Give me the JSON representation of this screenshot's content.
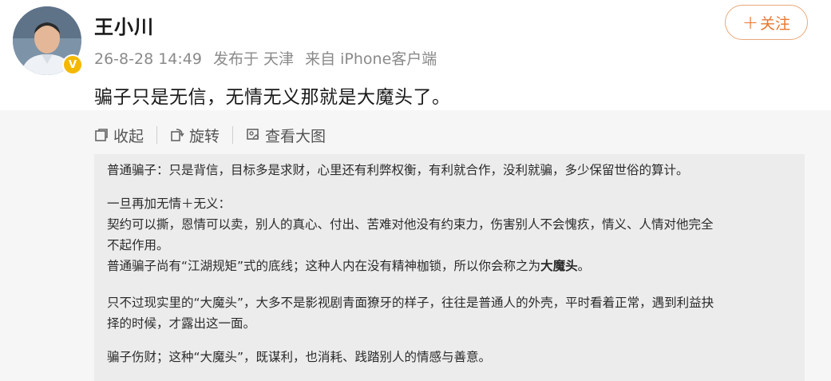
{
  "user": {
    "name": "王小川",
    "verified_badge": "V"
  },
  "meta": {
    "time": "26-8-28 14:49",
    "published_at": "发布于 天津",
    "source": "来自 iPhone客户端"
  },
  "follow_button": {
    "plus": "+",
    "label": "关注"
  },
  "post": {
    "text": "骗子只是无信，无情无义那就是大魔头了。"
  },
  "toolbar": {
    "collapse_label": "收起",
    "rotate_label": "旋转",
    "view_large_label": "查看大图"
  },
  "image_text": {
    "line1": "普通骗子：只是背信，目标多是求财，心里还有利弊权衡，有利就合作，没利就骗，多少保留世俗的算计。",
    "line2": "一旦再加无情＋无义：",
    "line3": "契约可以撕，恩情可以卖，别人的真心、付出、苦难对他没有约束力，伤害别人不会愧疚，情义、人情对他完全",
    "line4": "不起作用。",
    "line5a": "普通骗子尚有“江湖规矩”式的底线；这种人内在没有精神枷锁，所以你会称之为",
    "line5b": "大魔头",
    "line5c": "。",
    "line6": "只不过现实里的“大魔头”，大多不是影视剧青面獠牙的样子，往往是普通人的外壳，平时看着正常，遇到利益抉",
    "line7": "择的时候，才露出这一面。",
    "line8": "骗子伤财；这种“大魔头”，既谋利，也消耗、践踏别人的情感与善意。"
  },
  "colors": {
    "follow_accent": "#e8772e",
    "meta_gray": "#8a8a8a",
    "panel_bg": "#f6f6f6",
    "verified_gold": "#f5b800"
  }
}
